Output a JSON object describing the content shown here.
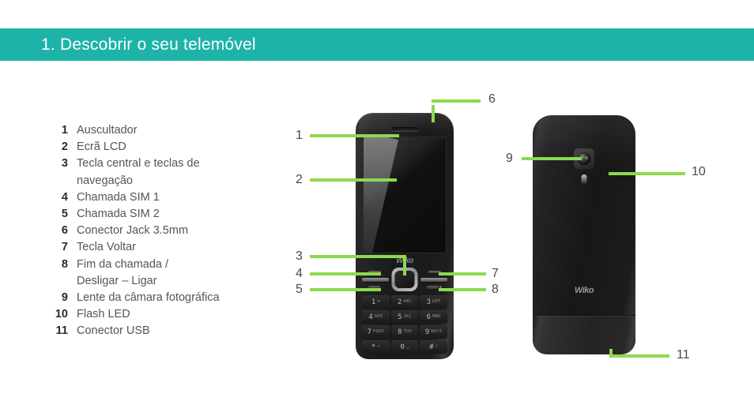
{
  "header": {
    "title": "1. Descobrir o seu telemóvel",
    "background_color": "#1db3a9",
    "text_color": "#ffffff"
  },
  "colors": {
    "accent_green": "#8dd94f",
    "teal": "#1db3a9",
    "legend_text": "#555555",
    "legend_number": "#2b2b2b"
  },
  "legend": {
    "items": [
      {
        "number": "1",
        "label": "Auscultador"
      },
      {
        "number": "2",
        "label": "Ecrã LCD"
      },
      {
        "number": "3",
        "label": "Tecla central e teclas de",
        "label_line2": "navegação"
      },
      {
        "number": "4",
        "label": "Chamada SIM 1"
      },
      {
        "number": "5",
        "label": "Chamada SIM 2"
      },
      {
        "number": "6",
        "label": "Conector Jack 3.5mm"
      },
      {
        "number": "7",
        "label": "Tecla Voltar"
      },
      {
        "number": "8",
        "label": "Fim da chamada /",
        "label_line2": "Desligar – Ligar"
      },
      {
        "number": "9",
        "label": "Lente da câmara fotográfica"
      },
      {
        "number": "10",
        "label": "Flash LED"
      },
      {
        "number": "11",
        "label": "Conector USB"
      }
    ]
  },
  "callouts": {
    "c1": "1",
    "c2": "2",
    "c3": "3",
    "c4": "4",
    "c5": "5",
    "c6": "6",
    "c7": "7",
    "c8": "8",
    "c9": "9",
    "c10": "10",
    "c11": "11"
  },
  "phone_front": {
    "brand_logo": "Wiko",
    "keypad": [
      {
        "digit": "1",
        "letters": "∞"
      },
      {
        "digit": "2",
        "letters": "ABC"
      },
      {
        "digit": "3",
        "letters": "DEF"
      },
      {
        "digit": "4",
        "letters": "GHI"
      },
      {
        "digit": "5",
        "letters": "JKL"
      },
      {
        "digit": "6",
        "letters": "MNO"
      },
      {
        "digit": "7",
        "letters": "PQRS"
      },
      {
        "digit": "8",
        "letters": "TUV"
      },
      {
        "digit": "9",
        "letters": "WXYZ"
      },
      {
        "digit": "*",
        "letters": "+"
      },
      {
        "digit": "0",
        "letters": "␣"
      },
      {
        "digit": "#",
        "letters": "♪"
      }
    ]
  },
  "phone_back": {
    "brand_logo": "Wiko"
  }
}
